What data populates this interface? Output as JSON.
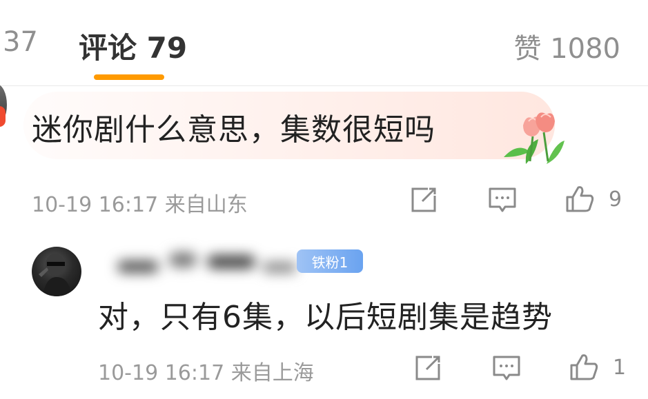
{
  "tabs": {
    "previous_count": "37",
    "comments_label": "评论 79",
    "likes_label": "赞 1080"
  },
  "comment": {
    "text": "迷你剧什么意思，集数很短吗",
    "meta": "10-19 16:17  来自山东",
    "like_count": "9",
    "sticker": "tulip-sticker"
  },
  "reply": {
    "badge": "铁粉1",
    "text": "对，只有6集，以后短剧集是趋势",
    "meta": "10-19 16:17  来自上海",
    "like_count": "1"
  },
  "colors": {
    "accent": "#ff9a00",
    "badge": "#6aa3f0",
    "bubble": "#ffe4dc"
  }
}
